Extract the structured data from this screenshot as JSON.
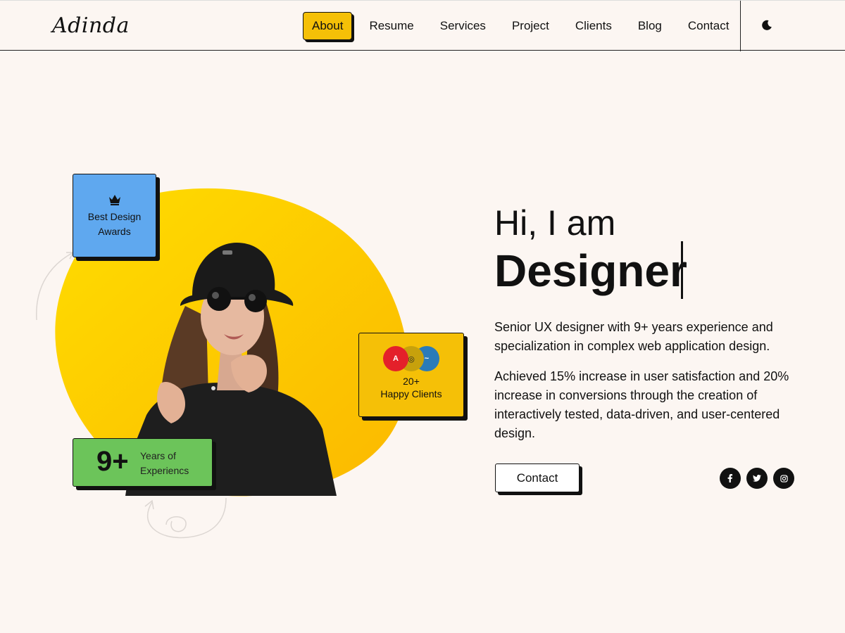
{
  "header": {
    "logo": "Adinda",
    "nav": [
      {
        "label": "About",
        "active": true
      },
      {
        "label": "Resume"
      },
      {
        "label": "Services"
      },
      {
        "label": "Project"
      },
      {
        "label": "Clients"
      },
      {
        "label": "Blog"
      },
      {
        "label": "Contact"
      }
    ],
    "theme_icon": "moon-icon"
  },
  "hero": {
    "greeting": "Hi, I am",
    "role": "Designer",
    "description_1": "Senior UX designer with 9+ years experience and specialization in complex web application design.",
    "description_2": "Achieved 15% increase in user satisfaction and 20% increase in conversions through the creation of interactively tested, data-driven, and user-centered design.",
    "contact_button": "Contact",
    "socials": [
      "facebook-icon",
      "twitter-icon",
      "instagram-icon"
    ]
  },
  "cards": {
    "awards": {
      "icon": "crown-icon",
      "line1": "Best Design",
      "line2": "Awards"
    },
    "clients": {
      "count": "20+",
      "label": "Happy Clients",
      "logo_1": "A"
    },
    "years": {
      "number": "9+",
      "line1": "Years of",
      "line2": "Experiencs"
    }
  },
  "colors": {
    "accent_yellow": "#f5c007",
    "card_blue": "#5fa8ef",
    "card_green": "#6cc45a",
    "background": "#fcf6f2"
  }
}
